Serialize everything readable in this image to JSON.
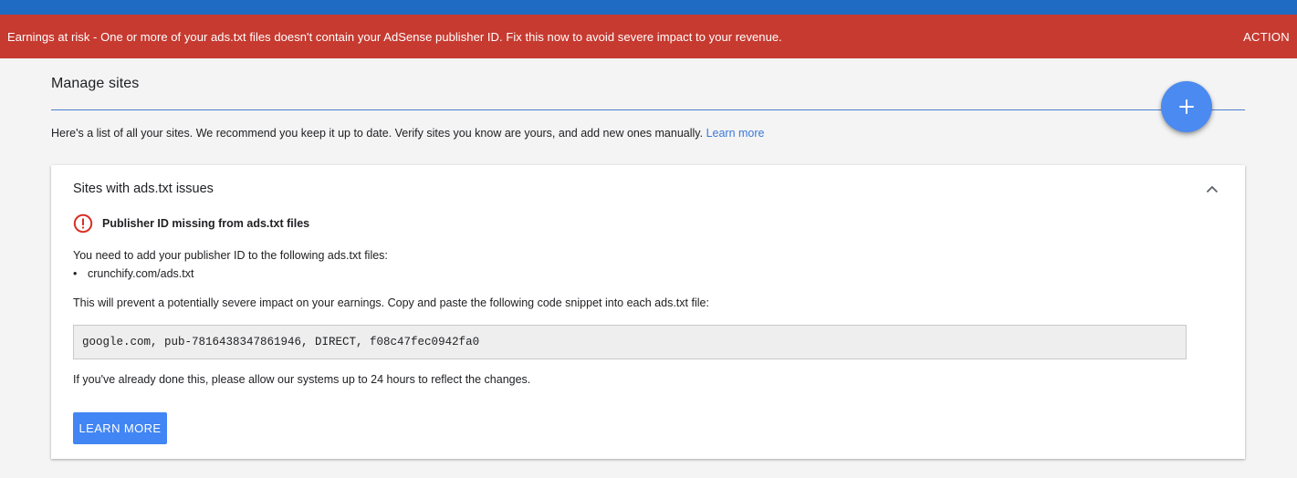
{
  "alert": {
    "message": "Earnings at risk - One or more of your ads.txt files doesn't contain your AdSense publisher ID. Fix this now to avoid severe impact to your revenue.",
    "action_label": "ACTION"
  },
  "page": {
    "title": "Manage sites",
    "intro": "Here's a list of all your sites. We recommend you keep it up to date. Verify sites you know are yours, and add new ones manually.",
    "learn_more_link": "Learn more"
  },
  "fab": {
    "icon": "plus-icon"
  },
  "card": {
    "title": "Sites with ads.txt issues",
    "collapse_icon": "chevron-up-icon",
    "issue_icon": "error-icon",
    "issue_title": "Publisher ID missing from ads.txt files",
    "need_text": "You need to add your publisher ID to the following ads.txt files:",
    "files": [
      "crunchify.com/ads.txt"
    ],
    "prevent_text": "This will prevent a potentially severe impact on your earnings. Copy and paste the following code snippet into each ads.txt file:",
    "snippet": "google.com, pub-7816438347861946, DIRECT, f08c47fec0942fa0",
    "done_text": "If you've already done this, please allow our systems up to 24 hours to reflect the changes.",
    "button_label": "LEARN MORE"
  },
  "colors": {
    "top_bar": "#1f6bc4",
    "alert_bg": "#c63a30",
    "fab": "#4b8af0",
    "primary_button": "#4285f4",
    "error_icon": "#d93025",
    "link": "#3b78d8"
  }
}
